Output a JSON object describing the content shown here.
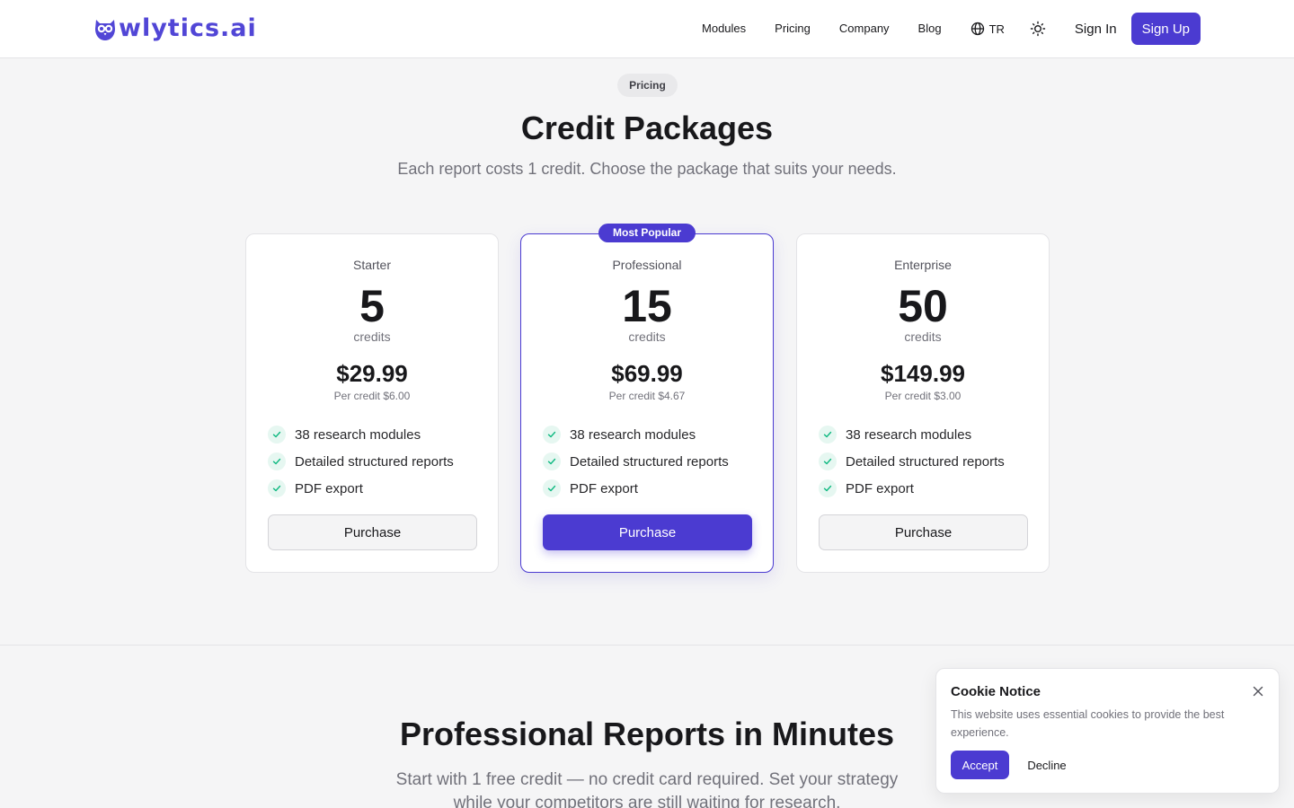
{
  "header": {
    "logo_text": "wlytics.ai",
    "logo_icon": "owl-icon",
    "nav": [
      "Modules",
      "Pricing",
      "Company",
      "Blog"
    ],
    "language": "TR",
    "language_icon": "globe-icon",
    "theme_icon": "sun-icon",
    "sign_in": "Sign In",
    "sign_up": "Sign Up"
  },
  "hero": {
    "pill": "Pricing",
    "title": "Credit Packages",
    "subtitle": "Each report costs 1 credit. Choose the package that suits your needs."
  },
  "packages": [
    {
      "name": "Starter",
      "credits": "5",
      "credits_unit": "credits",
      "price": "$29.99",
      "per_credit": "Per credit $6.00",
      "features": [
        "38 research modules",
        "Detailed structured reports",
        "PDF export"
      ],
      "button": "Purchase"
    },
    {
      "name": "Professional",
      "badge": "Most Popular",
      "credits": "15",
      "credits_unit": "credits",
      "price": "$69.99",
      "per_credit": "Per credit $4.67",
      "features": [
        "38 research modules",
        "Detailed structured reports",
        "PDF export"
      ],
      "button": "Purchase"
    },
    {
      "name": "Enterprise",
      "credits": "50",
      "credits_unit": "credits",
      "price": "$149.99",
      "per_credit": "Per credit $3.00",
      "features": [
        "38 research modules",
        "Detailed structured reports",
        "PDF export"
      ],
      "button": "Purchase"
    }
  ],
  "lower": {
    "title": "Professional Reports in Minutes",
    "subtitle": "Start with 1 free credit — no credit card required. Set your strategy while your competitors are still waiting for research."
  },
  "cookie": {
    "title": "Cookie Notice",
    "text": "This website uses essential cookies to provide the best experience.",
    "accept": "Accept",
    "decline": "Decline",
    "close_icon": "close-icon"
  },
  "colors": {
    "accent": "#4b3bd1",
    "check_bg": "#e6f7f1",
    "check_mark": "#10b981"
  }
}
